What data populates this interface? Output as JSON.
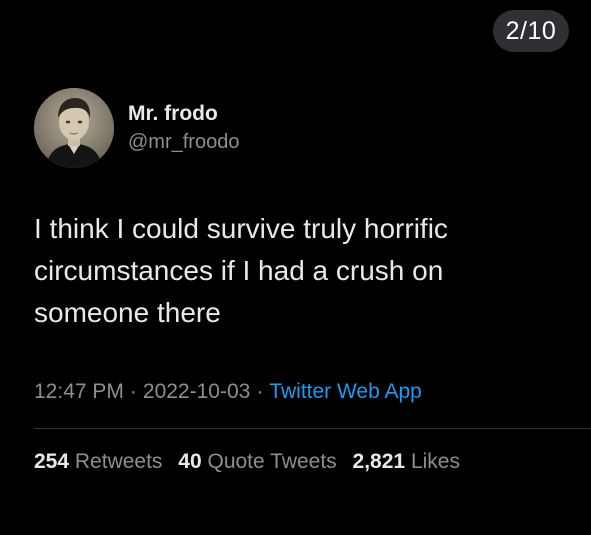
{
  "page_indicator": "2/10",
  "author": {
    "display_name": "Mr. frodo",
    "handle": "@mr_froodo",
    "avatar_icon": "vintage-portrait-avatar"
  },
  "tweet": {
    "text": "I think I could survive truly horrific circumstances if I had a crush on someone there",
    "time": "12:47 PM",
    "date": "2022-10-03",
    "source": "Twitter Web App",
    "separator": "·"
  },
  "stats": {
    "retweets_count": "254",
    "retweets_label": "Retweets",
    "quote_tweets_count": "40",
    "quote_tweets_label": "Quote Tweets",
    "likes_count": "2,821",
    "likes_label": "Likes"
  },
  "colors": {
    "background": "#000000",
    "text": "#e7e9ea",
    "secondary_text": "#8b8f94",
    "link": "#1d9bf0",
    "badge": "#2f3033"
  }
}
